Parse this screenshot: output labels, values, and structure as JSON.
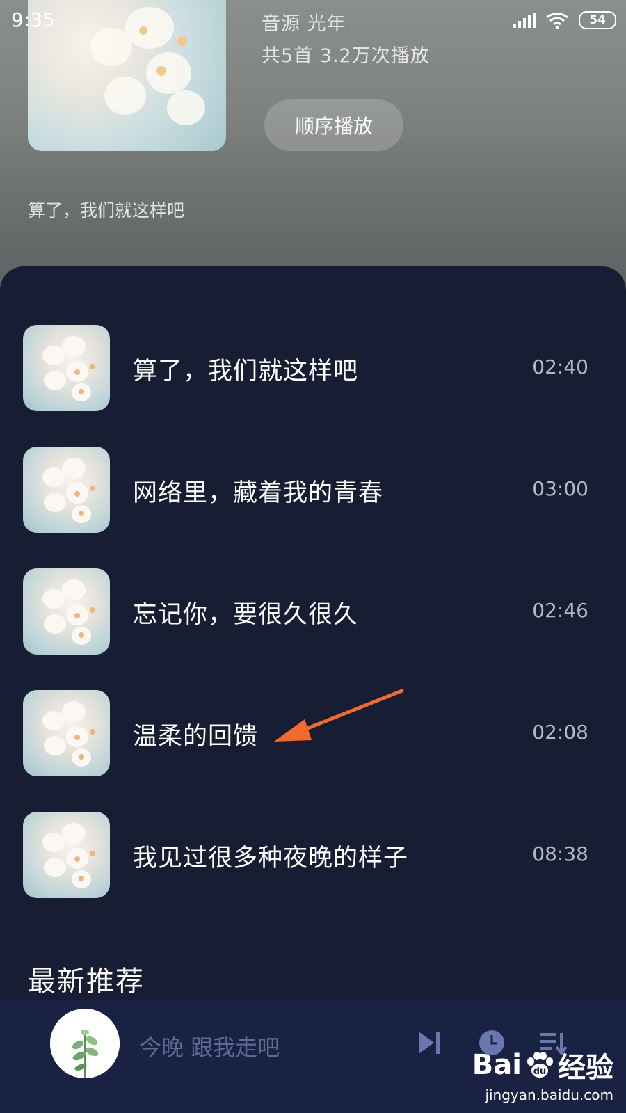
{
  "status_bar": {
    "time": "9:35",
    "battery": "54"
  },
  "album": {
    "source_line": "音源  光年",
    "stats_line": "共5首  3.2万次播放",
    "play_order_label": "顺序播放",
    "description": "算了，我们就这样吧"
  },
  "songs": [
    {
      "title": "算了，我们就这样吧",
      "duration": "02:40"
    },
    {
      "title": "网络里，藏着我的青春",
      "duration": "03:00"
    },
    {
      "title": "忘记你，要很久很久",
      "duration": "02:46"
    },
    {
      "title": "温柔的回馈",
      "duration": "02:08"
    },
    {
      "title": "我见过很多种夜晚的样子",
      "duration": "08:38"
    }
  ],
  "section": {
    "latest_title": "最新推荐"
  },
  "player": {
    "track": "今晚 跟我走吧"
  },
  "watermark": {
    "logo_text": "Bai",
    "logo_text2": "经验",
    "url": "jingyan.baidu.com"
  },
  "colors": {
    "sheet_bg": "#171e33",
    "player_bg": "#1a2243",
    "control_icon": "#6a77ad",
    "annotation_arrow": "#f26a2e"
  }
}
